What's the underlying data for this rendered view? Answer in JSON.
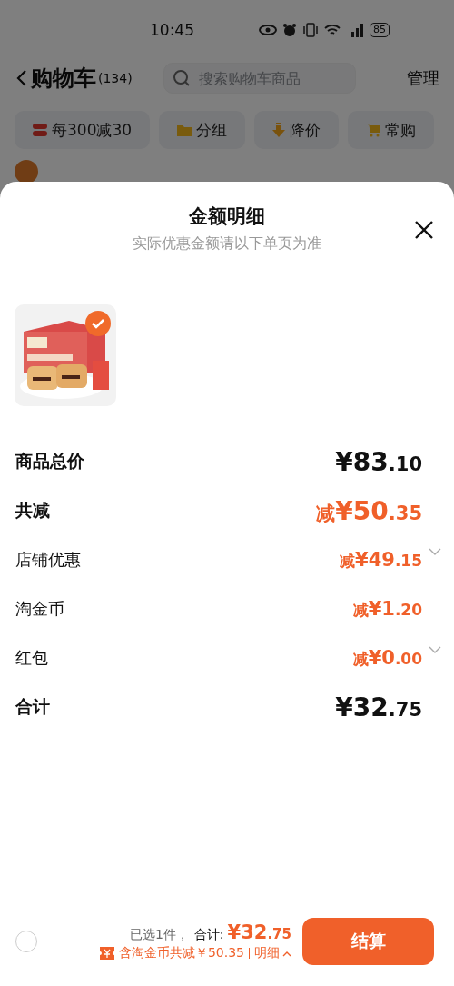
{
  "status_bar": {
    "time": "10:45",
    "battery": "85"
  },
  "header": {
    "title": "购物车",
    "count": "(134)",
    "search": {
      "placeholder": "搜索购物车商品"
    },
    "action": "管理"
  },
  "chips": [
    {
      "label": "每300减30",
      "kind": "coupon"
    },
    {
      "label": "分组",
      "kind": "folder"
    },
    {
      "label": "降价",
      "kind": "drop"
    },
    {
      "label": "常购",
      "kind": "cart"
    }
  ],
  "sheet": {
    "title": "金额明细",
    "subtitle": "实际优惠金额请以下单页为准",
    "products": [
      {
        "kind": "picture",
        "selected": true
      }
    ],
    "rows": [
      {
        "label": "商品总价",
        "kind": "total",
        "value": "¥83.10",
        "expandable": false
      },
      {
        "label": "共减",
        "kind": "discount",
        "value": "减¥50.35",
        "expandable": false
      },
      {
        "label": "店铺优惠",
        "kind": "sub",
        "value": "减¥49.15",
        "expandable": true
      },
      {
        "label": "淘金币",
        "kind": "sub",
        "value": "减¥1.20",
        "expandable": false
      },
      {
        "label": "红包",
        "kind": "sub",
        "value": "减¥0.00",
        "expandable": true
      },
      {
        "label": "合计",
        "kind": "total",
        "value": "¥32.75",
        "expandable": false
      }
    ]
  },
  "bottom_bar": {
    "select_all": {
      "selected": false
    },
    "selected_text": "已选1件，",
    "total_label": "合计:",
    "total": "¥32.75",
    "savings": "含淘金币共减￥50.35",
    "details": "明细",
    "checkout": "结算"
  }
}
